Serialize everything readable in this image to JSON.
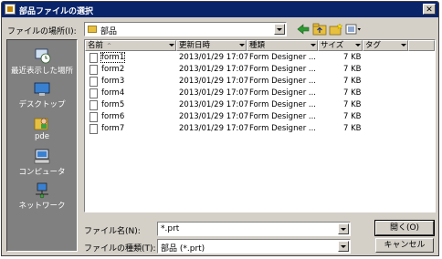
{
  "dialog": {
    "title": "部品ファイルの選択",
    "close_glyph": "✕"
  },
  "location": {
    "label": "ファイルの場所(I):",
    "value": "部品"
  },
  "places": [
    {
      "label": "最近表示した場所",
      "icon": "recent-places-icon"
    },
    {
      "label": "デスクトップ",
      "icon": "desktop-icon"
    },
    {
      "label": "pde",
      "icon": "user-folder-icon"
    },
    {
      "label": "コンピュータ",
      "icon": "computer-icon"
    },
    {
      "label": "ネットワーク",
      "icon": "network-icon"
    }
  ],
  "columns": {
    "name": "名前",
    "date": "更新日時",
    "type": "種類",
    "size": "サイズ",
    "tag": "タグ",
    "sort_glyph": "^"
  },
  "files": [
    {
      "name": "form1",
      "date": "2013/01/29 17:07",
      "type": "Form Designer ...",
      "size": "7 KB"
    },
    {
      "name": "form2",
      "date": "2013/01/29 17:07",
      "type": "Form Designer ...",
      "size": "7 KB"
    },
    {
      "name": "form3",
      "date": "2013/01/29 17:07",
      "type": "Form Designer ...",
      "size": "7 KB"
    },
    {
      "name": "form4",
      "date": "2013/01/29 17:07",
      "type": "Form Designer ...",
      "size": "7 KB"
    },
    {
      "name": "form5",
      "date": "2013/01/29 17:07",
      "type": "Form Designer ...",
      "size": "7 KB"
    },
    {
      "name": "form6",
      "date": "2013/01/29 17:07",
      "type": "Form Designer ...",
      "size": "7 KB"
    },
    {
      "name": "form7",
      "date": "2013/01/29 17:07",
      "type": "Form Designer ...",
      "size": "7 KB"
    }
  ],
  "filename": {
    "label": "ファイル名(N):",
    "value": "*.prt"
  },
  "filetype": {
    "label": "ファイルの種類(T):",
    "value": "部品 (*.prt)"
  },
  "buttons": {
    "open": "開く(O)",
    "cancel": "キャンセル"
  },
  "colors": {
    "titlebar": "#0a246a",
    "face": "#d4d0c8",
    "sidebar": "#808080"
  }
}
